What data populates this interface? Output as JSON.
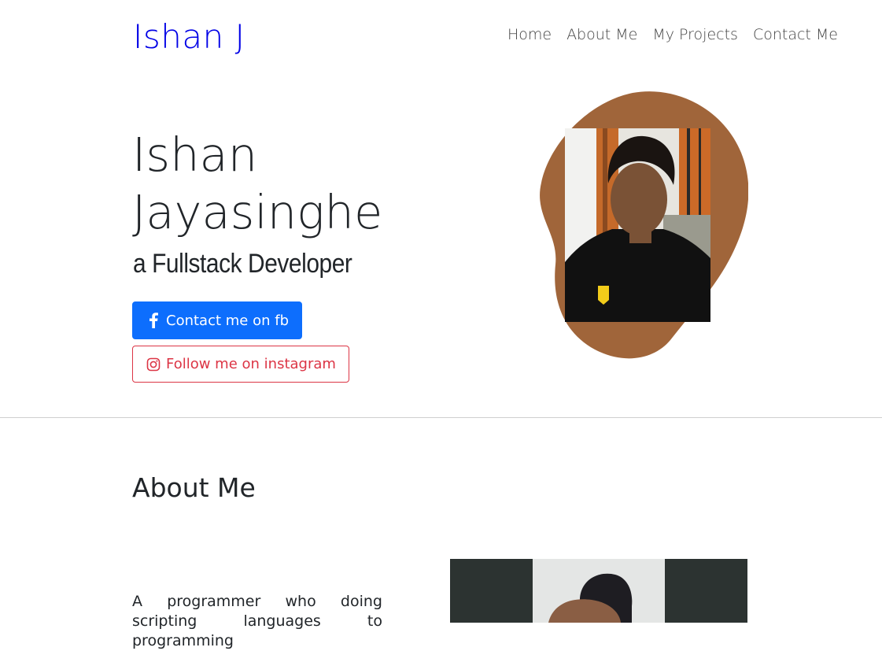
{
  "header": {
    "brand": "Ishan J",
    "nav": [
      "Home",
      "About Me",
      "My Projects",
      "Contact Me"
    ]
  },
  "hero": {
    "first_name": "Ishan",
    "last_name": "Jayasinghe",
    "role": "a Fullstack Developer",
    "fb_button": "Contact me on fb",
    "ig_button": "Follow me on instagram"
  },
  "about": {
    "title": "About Me",
    "text": "A programmer who doing scripting languages to programming"
  },
  "colors": {
    "brand": "#0000e6",
    "primary": "#0d6efd",
    "danger": "#dc3545",
    "blob": "#a0653a"
  },
  "icons": [
    "facebook-icon",
    "instagram-icon"
  ]
}
